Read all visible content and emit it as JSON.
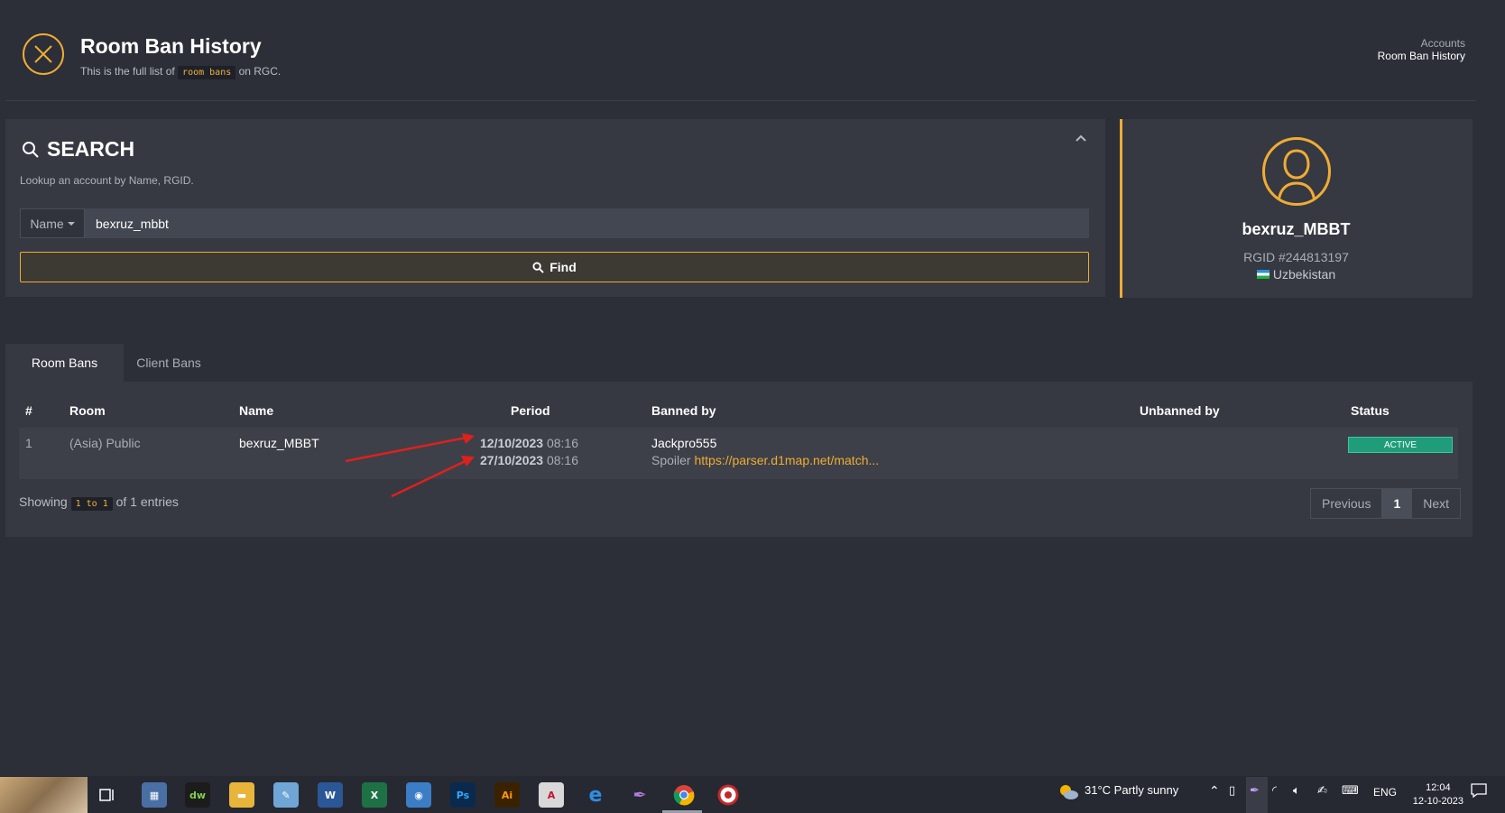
{
  "header": {
    "title": "Room Ban History",
    "subtitle_pre": "This is the full list of",
    "subtitle_code": "room bans",
    "subtitle_post": "on RGC.",
    "breadcrumb": [
      "Accounts",
      "Room Ban History"
    ]
  },
  "search": {
    "title": "SEARCH",
    "description": "Lookup an account by Name, RGID.",
    "type_label": "Name",
    "value": "bexruz_mbbt",
    "find_label": "Find"
  },
  "profile": {
    "name": "bexruz_MBBT",
    "rgid": "RGID #244813197",
    "country": "Uzbekistan"
  },
  "tabs": [
    {
      "label": "Room Bans",
      "active": true
    },
    {
      "label": "Client Bans",
      "active": false
    }
  ],
  "table": {
    "columns": [
      "#",
      "Room",
      "Name",
      "Period",
      "Banned by",
      "Unbanned by",
      "Status"
    ],
    "rows": [
      {
        "num": "1",
        "room": "(Asia) Public",
        "name": "bexruz_MBBT",
        "period_start_date": "12/10/2023",
        "period_start_time": "08:16",
        "period_end_date": "27/10/2023",
        "period_end_time": "08:16",
        "banned_by": "Jackpro555",
        "reason_label": "Spoiler",
        "reason_link": "https://parser.d1map.net/match...",
        "unbanned_by": "",
        "status": "ACTIVE"
      }
    ],
    "showing_pre": "Showing",
    "showing_range": "1 to 1",
    "showing_post": "of 1 entries",
    "pagination": {
      "previous": "Previous",
      "current": "1",
      "next": "Next"
    }
  },
  "taskbar": {
    "weather": "31°C  Partly sunny",
    "language": "ENG",
    "time": "12:04",
    "date": "12-10-2023",
    "apps": [
      "task-view",
      "calculator",
      "dreamweaver",
      "file-explorer",
      "paint",
      "word",
      "excel",
      "media-player",
      "photoshop",
      "illustrator",
      "acrobat",
      "edge",
      "feather",
      "chrome",
      "app"
    ]
  },
  "colors": {
    "accent": "#f0ac33",
    "status_active": "#1f9d7b",
    "background": "#2c2f38",
    "panel": "#363942"
  }
}
